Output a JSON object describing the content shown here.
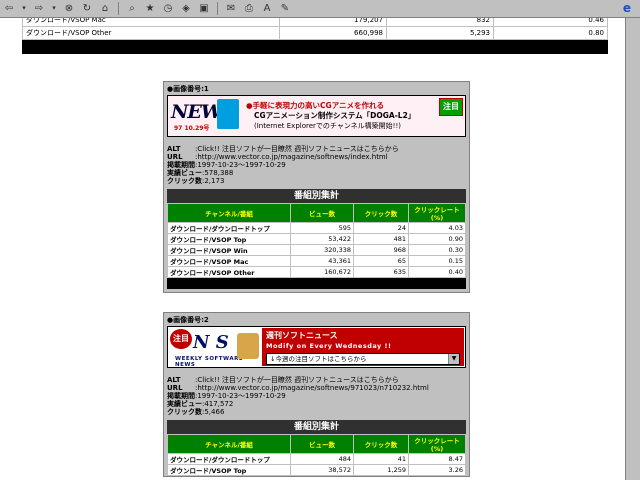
{
  "toolbar": {
    "icons": [
      "back-icon",
      "dropdown-arrow-icon",
      "forward-icon",
      "dropdown-arrow-icon",
      "stop-icon",
      "refresh-icon",
      "home-icon",
      "search-icon",
      "favorites-icon",
      "history-icon",
      "channels-icon",
      "fullscreen-icon",
      "mail-icon",
      "print-icon",
      "font-icon",
      "edit-icon"
    ]
  },
  "top_table": {
    "rows": [
      {
        "name": "ダウンロード/VSOP Mac",
        "views": "179,207",
        "clicks": "832",
        "rate": "0.46"
      },
      {
        "name": "ダウンロード/VSOP Other",
        "views": "660,998",
        "clicks": "5,293",
        "rate": "0.80"
      }
    ]
  },
  "box1": {
    "label": "●画像番号:1",
    "banner": {
      "logo_word": "NEWS",
      "logo_date": "97 10.29号",
      "title": "●手軽に表現力の高いCGアニメを作れる",
      "subtitle": "CGアニメーション制作システム「DOGA-L2」",
      "paren": "(Internet Explorerでのチャンネル構築開始!!)",
      "badge": "注目"
    },
    "meta": {
      "alt_key": "ALT",
      "alt_val": ":Click!! 注目ソフトが一目瞭然 週刊ソフトニュースはこちらから",
      "url_key": "URL",
      "url_val": ":http://www.vector.co.jp/magazine/softnews/index.html",
      "period_key": "掲載期間",
      "period_val": ":1997-10-23～1997-10-29",
      "views_key": "実績ビュー",
      "views_val": ":578,388",
      "clicks_key": "クリック数",
      "clicks_val": ":2,173"
    },
    "stats_title": "番組別集計",
    "headers": [
      "チャンネル/番組",
      "ビュー数",
      "クリック数",
      "クリックレート(%)"
    ],
    "rows": [
      {
        "name": "ダウンロード/ダウンロードトップ",
        "views": "595",
        "clicks": "24",
        "rate": "4.03"
      },
      {
        "name": "ダウンロード/VSOP Top",
        "views": "53,422",
        "clicks": "481",
        "rate": "0.90"
      },
      {
        "name": "ダウンロード/VSOP Win",
        "views": "320,338",
        "clicks": "968",
        "rate": "0.30"
      },
      {
        "name": "ダウンロード/VSOP Mac",
        "views": "43,361",
        "clicks": "65",
        "rate": "0.15"
      },
      {
        "name": "ダウンロード/VSOP Other",
        "views": "160,672",
        "clicks": "635",
        "rate": "0.40"
      }
    ]
  },
  "box2": {
    "label": "●画像番号:2",
    "banner": {
      "badge": "注目",
      "logo_word": "N  S",
      "weekly": "WEEKLY SOFTWARE NEWS",
      "head": "週刊ソフトニュース",
      "modify": "Modify on Every Wednesday !!",
      "select": "↓今週の注目ソフトはこちらから"
    },
    "meta": {
      "alt_key": "ALT",
      "alt_val": ":Click!! 注目ソフトが一目瞭然 週刊ソフトニュースはこちらから",
      "url_key": "URL",
      "url_val": ":http://www.vector.co.jp/magazine/softnews/971023/n710232.html",
      "period_key": "掲載期間",
      "period_val": ":1997-10-23～1997-10-29",
      "views_key": "実績ビュー",
      "views_val": ":417,572",
      "clicks_key": "クリック数",
      "clicks_val": ":5,466"
    },
    "stats_title": "番組別集計",
    "headers": [
      "チャンネル/番組",
      "ビュー数",
      "クリック数",
      "クリックレート(%)"
    ],
    "rows": [
      {
        "name": "ダウンロード/ダウンロードトップ",
        "views": "484",
        "clicks": "41",
        "rate": "8.47"
      },
      {
        "name": "ダウンロード/VSOP Top",
        "views": "38,572",
        "clicks": "1,259",
        "rate": "3.26"
      }
    ]
  }
}
